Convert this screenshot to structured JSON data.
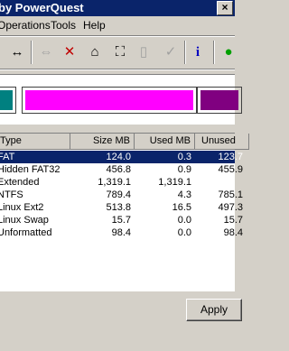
{
  "window": {
    "title": "by PowerQuest",
    "close_glyph": "×"
  },
  "menu": [
    {
      "label": "Operations"
    },
    {
      "label": "Tools"
    },
    {
      "label": "Help"
    }
  ],
  "toolbar": [
    {
      "name": "resize-icon",
      "glyph": "↔",
      "color": "#000000"
    },
    {
      "name": "copy-icon",
      "glyph": "⇔",
      "color": "#a0a0a0"
    },
    {
      "name": "delete-icon",
      "glyph": "✕",
      "color": "#c00000"
    },
    {
      "name": "label-icon",
      "glyph": "⌂",
      "color": "#000000"
    },
    {
      "name": "format-icon",
      "glyph": "⛶",
      "color": "#000000"
    },
    {
      "name": "info-blank-icon",
      "glyph": "▯",
      "color": "#a0a0a0"
    },
    {
      "name": "check-icon",
      "glyph": "✓",
      "color": "#a0a0a0"
    },
    {
      "name": "info-icon",
      "glyph": "i",
      "color": "#0000c0"
    },
    {
      "name": "apply-changes-icon",
      "glyph": "●",
      "color": "#00a000"
    }
  ],
  "disk_map": {
    "partitions": [
      {
        "name": "partition-block-fat",
        "color": "#008080"
      },
      {
        "name": "partition-block-extended",
        "color": "#ff00ff"
      },
      {
        "name": "partition-block-other",
        "color": "#800080"
      }
    ]
  },
  "table": {
    "headers": [
      "Type",
      "Size MB",
      "Used MB",
      "Unused"
    ],
    "rows": [
      {
        "type": "FAT",
        "size": "124.0",
        "used": "0.3",
        "unused": "123.7",
        "selected": true
      },
      {
        "type": "Hidden FAT32",
        "size": "456.8",
        "used": "0.9",
        "unused": "455.9"
      },
      {
        "type": "Extended",
        "size": "1,319.1",
        "used": "1,319.1",
        "unused": ""
      },
      {
        "type": "NTFS",
        "size": "789.4",
        "used": "4.3",
        "unused": "785.1"
      },
      {
        "type": "Linux Ext2",
        "size": "513.8",
        "used": "16.5",
        "unused": "497.3"
      },
      {
        "type": "Linux Swap",
        "size": "15.7",
        "used": "0.0",
        "unused": "15.7"
      },
      {
        "type": "Unformatted",
        "size": "98.4",
        "used": "0.0",
        "unused": "98.4"
      }
    ]
  },
  "buttons": {
    "apply": "Apply"
  }
}
